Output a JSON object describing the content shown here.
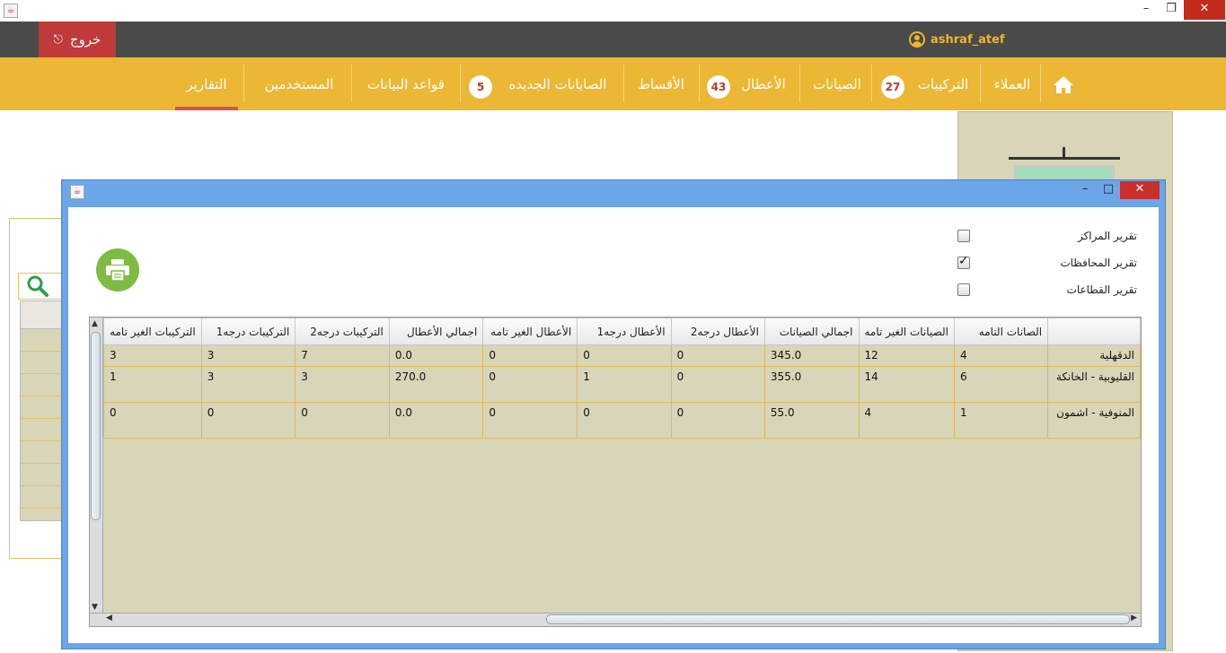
{
  "window": {
    "minimize_icon": "minimize-icon",
    "maximize_icon": "restore-icon",
    "close_icon": "close-icon"
  },
  "header": {
    "exit_label": "خروج",
    "username": "ashraf_atef"
  },
  "nav": {
    "items": [
      {
        "label": "العملاء"
      },
      {
        "label": "التركيبات",
        "badge": "27"
      },
      {
        "label": "الصيانات"
      },
      {
        "label": "الأعطال",
        "badge": "43"
      },
      {
        "label": "الأقساط"
      },
      {
        "label": "الصايانات الجديده",
        "badge": "5"
      },
      {
        "label": "قواعد البيانات"
      },
      {
        "label": "المستخدمين"
      },
      {
        "label": "التقارير",
        "active": true
      }
    ]
  },
  "dialog": {
    "options": [
      {
        "label": "تقرير المراكز",
        "checked": false
      },
      {
        "label": "تقرير المحافظات",
        "checked": true
      },
      {
        "label": "تقرير القطاعات",
        "checked": false
      }
    ],
    "table": {
      "columns": [
        "",
        "الصانات التامه",
        "الصيانات الغير تامه",
        "اجمالي الصيانات",
        "الأعطال درجه2",
        "الأعطال درجه1",
        "الأعطال الغير تامه",
        "اجمالي الأعطال",
        "التركيبات درجه2",
        "التركيبات درجه1",
        "التركيبات الغير تامه"
      ],
      "rows": [
        [
          "الدقهلية",
          "4",
          "12",
          "345.0",
          "0",
          "0",
          "0",
          "0.0",
          "7",
          "3",
          "3"
        ],
        [
          "القليوبية - الخانكة",
          "6",
          "14",
          "355.0",
          "0",
          "1",
          "0",
          "270.0",
          "3",
          "3",
          "1"
        ],
        [
          "المنوفية - اشمون",
          "1",
          "4",
          "55.0",
          "0",
          "0",
          "0",
          "0.0",
          "0",
          "0",
          "0"
        ]
      ]
    }
  },
  "colors": {
    "nav_bg": "#ebb734",
    "header_bg": "#4a4a4a",
    "exit_bg": "#c0393b",
    "active_underline": "#d9534f",
    "table_bg": "#d8d5b8"
  }
}
